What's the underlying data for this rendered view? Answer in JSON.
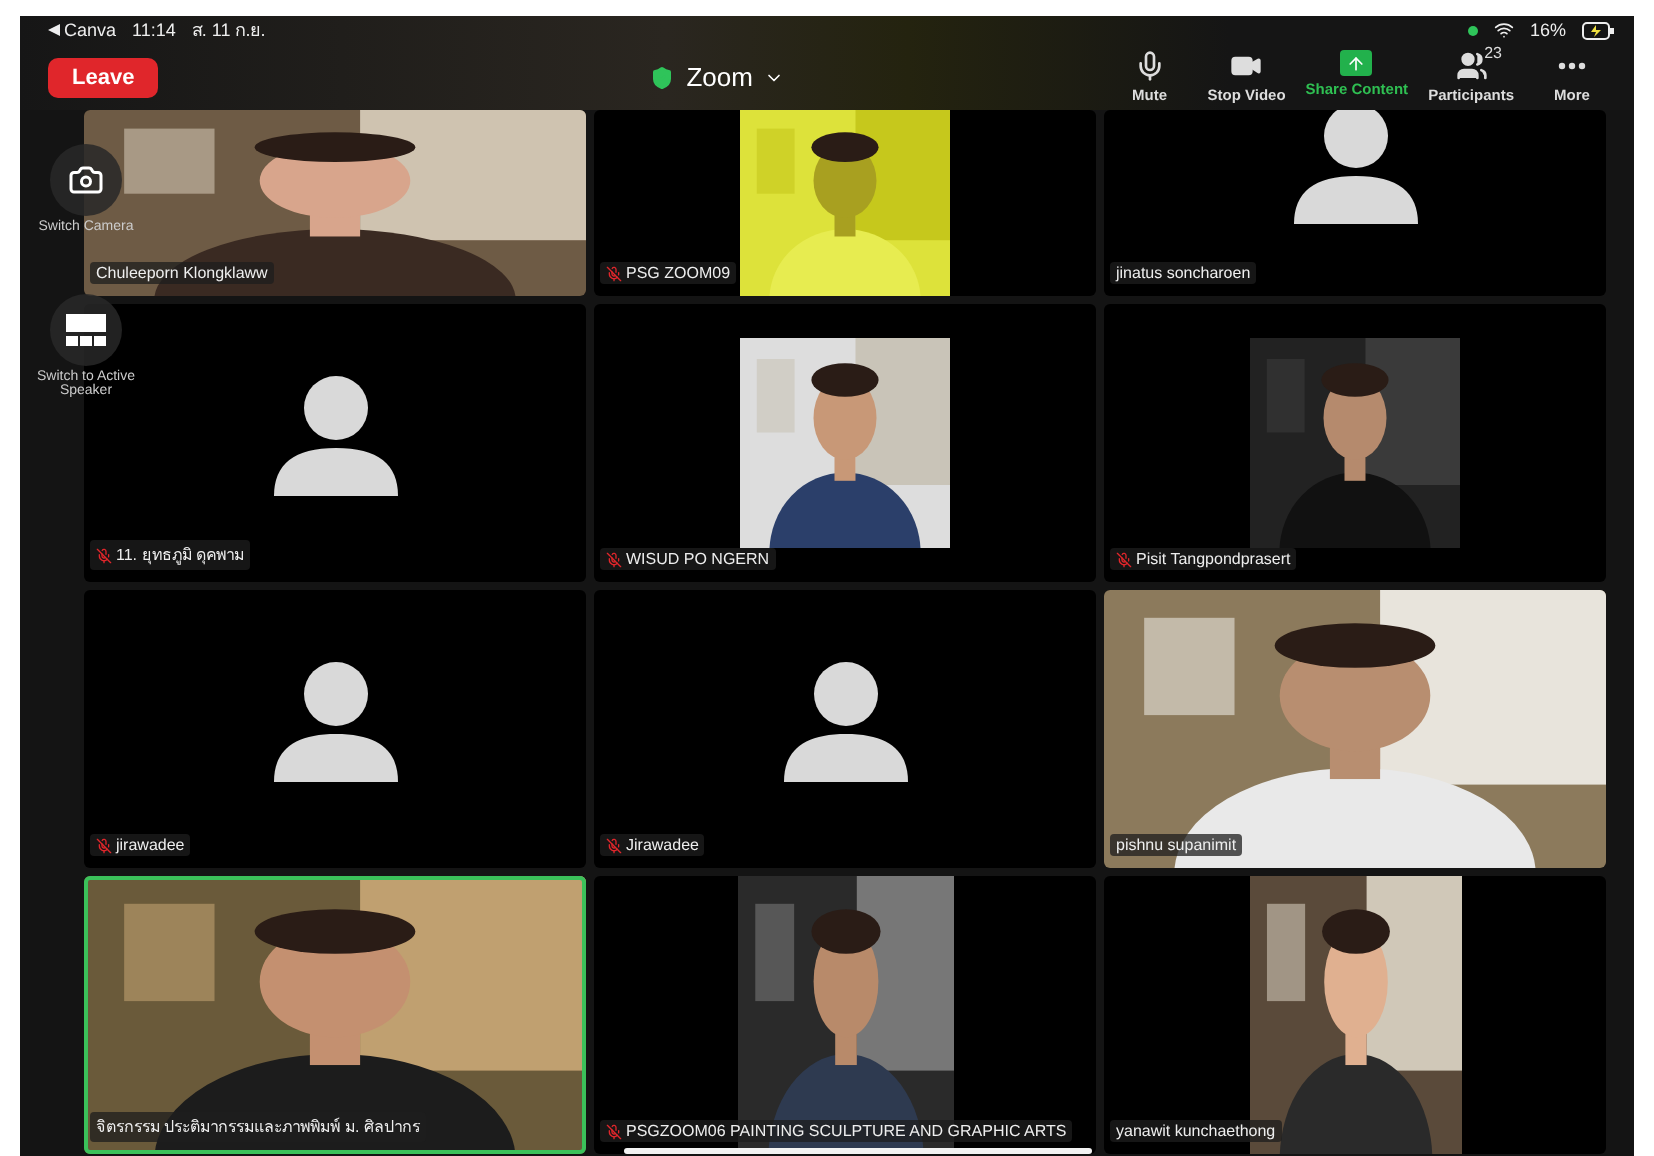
{
  "status_bar": {
    "back_app": "Canva",
    "time": "11:14",
    "date": "ส. 11 ก.ย.",
    "battery": "16%"
  },
  "meeting": {
    "leave_button": "Leave",
    "title": "Zoom"
  },
  "toolbar": [
    {
      "kind": "mic",
      "label": "Mute"
    },
    {
      "kind": "video",
      "label": "Stop Video"
    },
    {
      "kind": "share",
      "label": "Share Content",
      "active": true
    },
    {
      "kind": "participants",
      "label": "Participants",
      "count": "23"
    },
    {
      "kind": "more",
      "label": "More"
    }
  ],
  "side_controls": [
    {
      "kind": "camera",
      "label": "Switch Camera"
    },
    {
      "kind": "speaker",
      "label": "Switch to Active Speaker"
    }
  ],
  "tiles": [
    {
      "name": "Chuleeporn Klongklaww",
      "kind": "video",
      "muted": false,
      "active_speaker": false
    },
    {
      "name": "PSG ZOOM09",
      "kind": "video",
      "muted": true,
      "active_speaker": false
    },
    {
      "name": "jinatus soncharoen",
      "kind": "avatar",
      "muted": false,
      "active_speaker": false
    },
    {
      "name": "11. ยุทธภูมิ ดุคพาม",
      "kind": "avatar",
      "muted": true,
      "active_speaker": false
    },
    {
      "name": "WISUD PO NGERN",
      "kind": "video",
      "muted": true,
      "active_speaker": false
    },
    {
      "name": "Pisit Tangpondprasert",
      "kind": "video",
      "muted": true,
      "active_speaker": false
    },
    {
      "name": "jirawadee",
      "kind": "avatar",
      "muted": true,
      "active_speaker": false
    },
    {
      "name": "Jirawadee",
      "kind": "avatar",
      "muted": true,
      "active_speaker": false
    },
    {
      "name": "pishnu supanimit",
      "kind": "video",
      "muted": false,
      "active_speaker": false
    },
    {
      "name": "จิตรกรรม ประติมากรรมและภาพพิมพ์ ม. ศิลปากร",
      "kind": "video",
      "muted": false,
      "active_speaker": true
    },
    {
      "name": "PSGZOOM06 PAINTING SCULPTURE AND GRAPHIC ARTS",
      "kind": "video",
      "muted": true,
      "active_speaker": false
    },
    {
      "name": "yanawit kunchaethong",
      "kind": "video",
      "muted": false,
      "active_speaker": false
    }
  ]
}
